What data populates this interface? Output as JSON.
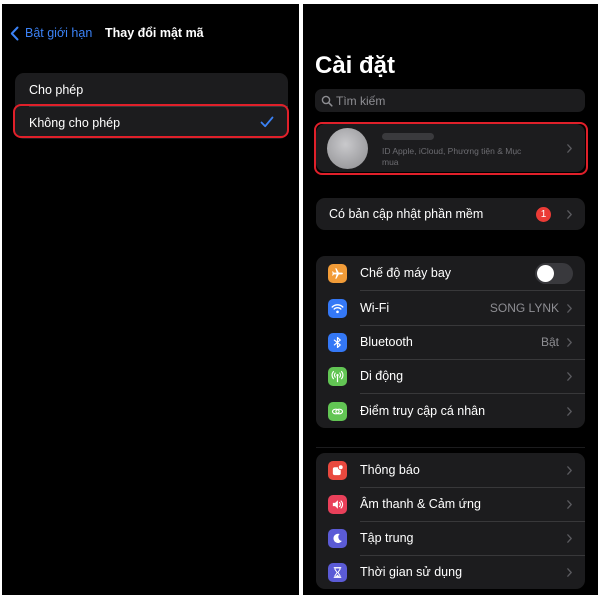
{
  "left": {
    "nav": {
      "back_label": "Bật giới hạn",
      "title": "Thay đổi mật mã"
    },
    "options": [
      {
        "label": "Cho phép",
        "selected": false
      },
      {
        "label": "Không cho phép",
        "selected": true
      }
    ]
  },
  "right": {
    "title": "Cài đặt",
    "search": {
      "placeholder": "Tìm kiếm"
    },
    "profile": {
      "subtitle": "ID Apple, iCloud, Phương tiện & Mục mua"
    },
    "update": {
      "label": "Có bản cập nhật phần mềm",
      "badge": "1"
    },
    "connectivity": [
      {
        "icon": "airplane-icon",
        "label": "Chế độ máy bay",
        "color": "#f29c38",
        "toggle_on": false
      },
      {
        "icon": "wifi-icon",
        "label": "Wi-Fi",
        "value": "SONG LYNK",
        "color": "#3478f6"
      },
      {
        "icon": "bluetooth-icon",
        "label": "Bluetooth",
        "value": "Bật",
        "color": "#3478f6"
      },
      {
        "icon": "cellular-icon",
        "label": "Di động",
        "color": "#62c554"
      },
      {
        "icon": "hotspot-icon",
        "label": "Điểm truy cập cá nhân",
        "color": "#62c554"
      }
    ],
    "notifications": [
      {
        "icon": "notifications-icon",
        "label": "Thông báo",
        "color": "#e9493f"
      },
      {
        "icon": "sound-icon",
        "label": "Âm thanh & Cảm ứng",
        "color": "#e9405a"
      },
      {
        "icon": "focus-moon-icon",
        "label": "Tập trung",
        "color": "#5b5bd6"
      },
      {
        "icon": "screen-time-hourglass-icon",
        "label": "Thời gian sử dụng",
        "color": "#5b5bd6"
      }
    ]
  },
  "colors": {
    "accent": "#3b82f6",
    "highlight": "#e0202a",
    "background": "#000000",
    "cell": "#1c1c1e"
  }
}
